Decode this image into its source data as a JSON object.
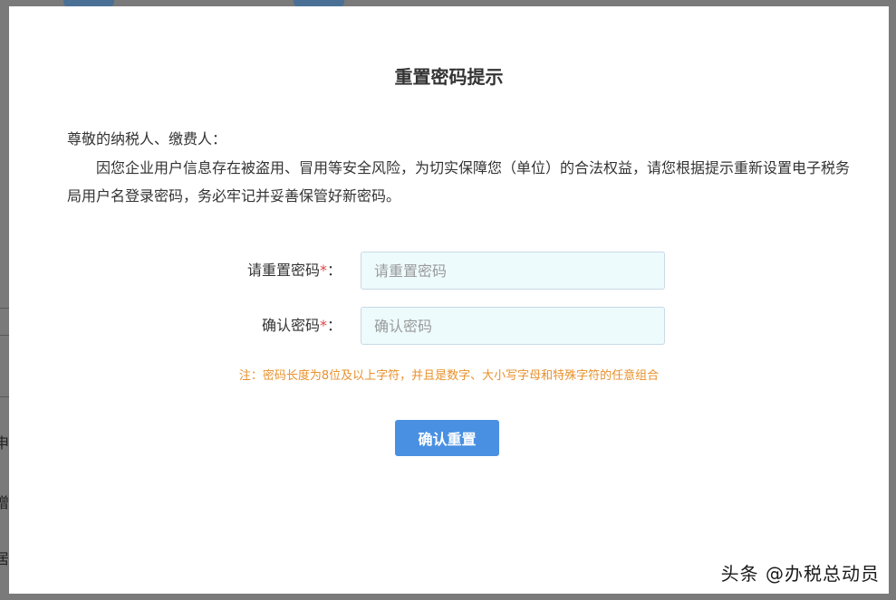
{
  "background": {
    "fragments": [
      "申",
      "增",
      "居"
    ]
  },
  "dialog": {
    "title": "重置密码提示",
    "greeting": "尊敬的纳税人、缴费人：",
    "message": "因您企业用户信息存在被盗用、冒用等安全风险，为切实保障您（单位）的合法权益，请您根据提示重新设置电子税务局用户名登录密码，务必牢记并妥善保管好新密码。",
    "fields": [
      {
        "label": "请重置密码",
        "required_mark": "*",
        "colon": "：",
        "placeholder": "请重置密码",
        "value": ""
      },
      {
        "label": "确认密码",
        "required_mark": "*",
        "colon": "：",
        "placeholder": "确认密码",
        "value": ""
      }
    ],
    "note": "注：密码长度为8位及以上字符，并且是数字、大小写字母和特殊字符的任意组合",
    "confirm_button": "确认重置"
  },
  "watermark": "头条 @办税总动员",
  "colors": {
    "primary_button": "#4a90e2",
    "note_text": "#e8912c",
    "required_mark": "#e04444",
    "input_background": "#eefbfd",
    "overlay": "#7a7a7a"
  }
}
